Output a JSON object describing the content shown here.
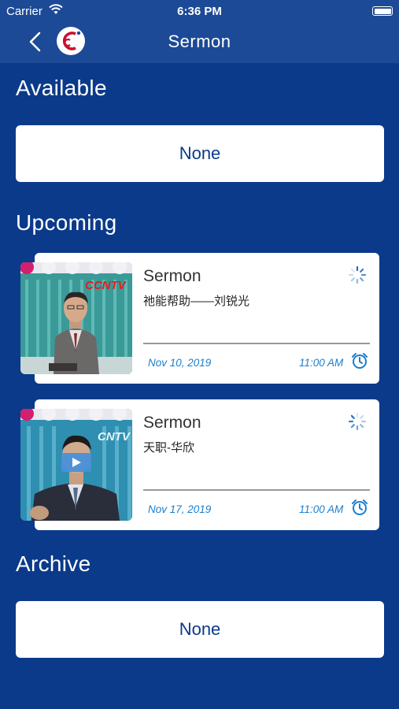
{
  "status_bar": {
    "carrier": "Carrier",
    "time": "6:36 PM"
  },
  "nav": {
    "title": "Sermon",
    "back_icon": "chevron-left-icon",
    "logo_text": "cC"
  },
  "sections": {
    "available": {
      "title": "Available",
      "empty_label": "None"
    },
    "upcoming": {
      "title": "Upcoming",
      "items": [
        {
          "title": "Sermon",
          "subtitle": "祂能帮助——刘锐光",
          "date": "Nov 10, 2019",
          "time": "11:00 AM",
          "thumb_logo": "CCNTV"
        },
        {
          "title": "Sermon",
          "subtitle": "天职-华欣",
          "date": "Nov 17, 2019",
          "time": "11:00 AM",
          "thumb_logo": "CNTV"
        }
      ]
    },
    "archive": {
      "title": "Archive",
      "empty_label": "None"
    }
  },
  "colors": {
    "background": "#0b3a8a",
    "header": "#1c4a96",
    "accent": "#1a7fd0"
  }
}
